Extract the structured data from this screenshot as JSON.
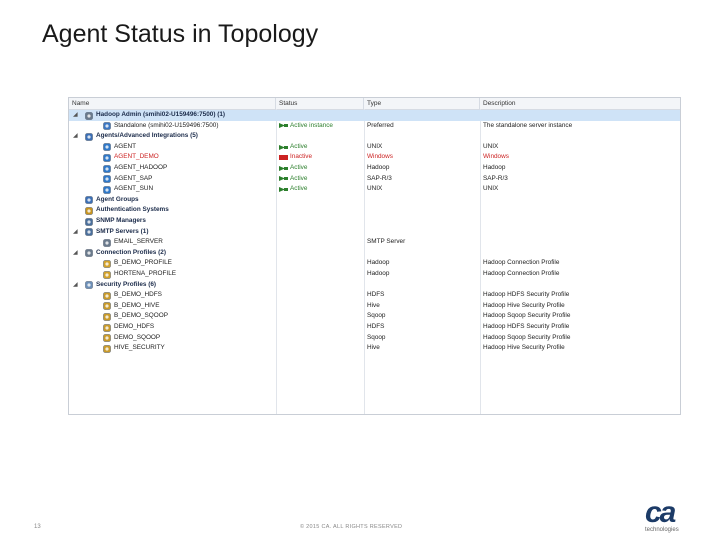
{
  "slide": {
    "title": "Agent Status in Topology",
    "page_number": "13",
    "copyright": "© 2015 CA. ALL RIGHTS RESERVED",
    "logo_text": "ca",
    "logo_subtext": "technologies"
  },
  "grid": {
    "columns": [
      "Name",
      "Status",
      "Type",
      "Description"
    ],
    "rows": [
      {
        "level": 0,
        "expander": "◢",
        "icon": "server-icon",
        "name": "Hadoop Admin (smihi02-U159496:7500) (1)",
        "bold": true,
        "status": "",
        "type": "",
        "desc": "",
        "selected": true
      },
      {
        "level": 1,
        "expander": "",
        "icon": "standalone-icon",
        "name": "Standalone (smihi02-U159496:7500)",
        "bold": false,
        "status": "Active instance",
        "status_kind": "ok",
        "type": "Preferred",
        "desc": "The standalone server instance",
        "desc_kind": "normal"
      },
      {
        "level": 0,
        "expander": "◢",
        "icon": "agent-group-icon",
        "name": "Agents/Advanced Integrations (5)",
        "bold": true,
        "status": "",
        "type": "",
        "desc": ""
      },
      {
        "level": 1,
        "expander": "",
        "icon": "agent-icon",
        "name": "AGENT",
        "bold": false,
        "status": "Active",
        "status_kind": "ok",
        "type": "UNIX",
        "desc": "UNIX"
      },
      {
        "level": 1,
        "expander": "",
        "icon": "agent-icon",
        "name": "AGENT_DEMO",
        "bold": false,
        "status": "Inactive",
        "status_kind": "bad",
        "type": "Windows",
        "desc": "Windows",
        "row_kind": "bad"
      },
      {
        "level": 1,
        "expander": "",
        "icon": "agent-icon",
        "name": "AGENT_HADOOP",
        "bold": false,
        "status": "Active",
        "status_kind": "ok",
        "type": "Hadoop",
        "desc": "Hadoop"
      },
      {
        "level": 1,
        "expander": "",
        "icon": "agent-icon",
        "name": "AGENT_SAP",
        "bold": false,
        "status": "Active",
        "status_kind": "ok",
        "type": "SAP-R/3",
        "desc": "SAP-R/3"
      },
      {
        "level": 1,
        "expander": "",
        "icon": "agent-icon",
        "name": "AGENT_SUN",
        "bold": false,
        "status": "Active",
        "status_kind": "ok",
        "type": "UNIX",
        "desc": "UNIX"
      },
      {
        "level": 0,
        "expander": "",
        "icon": "agent-groups-icon",
        "name": "Agent Groups",
        "bold": true,
        "status": "",
        "type": "",
        "desc": ""
      },
      {
        "level": 0,
        "expander": "",
        "icon": "auth-icon",
        "name": "Authentication Systems",
        "bold": true,
        "status": "",
        "type": "",
        "desc": ""
      },
      {
        "level": 0,
        "expander": "",
        "icon": "snmp-icon",
        "name": "SNMP Managers",
        "bold": true,
        "status": "",
        "type": "",
        "desc": ""
      },
      {
        "level": 0,
        "expander": "◢",
        "icon": "smtp-icon",
        "name": "SMTP Servers (1)",
        "bold": true,
        "status": "",
        "type": "",
        "desc": ""
      },
      {
        "level": 1,
        "expander": "",
        "icon": "email-server-icon",
        "name": "EMAIL_SERVER",
        "bold": false,
        "status": "",
        "type": "SMTP Server",
        "desc": ""
      },
      {
        "level": 0,
        "expander": "◢",
        "icon": "connection-icon",
        "name": "Connection Profiles (2)",
        "bold": true,
        "status": "",
        "type": "",
        "desc": ""
      },
      {
        "level": 1,
        "expander": "",
        "icon": "profile-icon",
        "name": "B_DEMO_PROFILE",
        "bold": false,
        "status": "",
        "type": "Hadoop",
        "desc": "Hadoop Connection Profile"
      },
      {
        "level": 1,
        "expander": "",
        "icon": "profile-icon",
        "name": "HORTENA_PROFILE",
        "bold": false,
        "status": "",
        "type": "Hadoop",
        "desc": "Hadoop Connection Profile"
      },
      {
        "level": 0,
        "expander": "◢",
        "icon": "security-icon",
        "name": "Security Profiles (6)",
        "bold": true,
        "status": "",
        "type": "",
        "desc": ""
      },
      {
        "level": 1,
        "expander": "",
        "icon": "sec-profile-icon",
        "name": "B_DEMO_HDFS",
        "bold": false,
        "status": "",
        "type": "HDFS",
        "desc": "Hadoop HDFS Security Profile"
      },
      {
        "level": 1,
        "expander": "",
        "icon": "sec-profile-icon",
        "name": "B_DEMO_HIVE",
        "bold": false,
        "status": "",
        "type": "Hive",
        "desc": "Hadoop Hive Security Profile"
      },
      {
        "level": 1,
        "expander": "",
        "icon": "sec-profile-icon",
        "name": "B_DEMO_SQOOP",
        "bold": false,
        "status": "",
        "type": "Sqoop",
        "desc": "Hadoop Sqoop Security Profile"
      },
      {
        "level": 1,
        "expander": "",
        "icon": "sec-profile-icon",
        "name": "DEMO_HDFS",
        "bold": false,
        "status": "",
        "type": "HDFS",
        "desc": "Hadoop HDFS Security Profile"
      },
      {
        "level": 1,
        "expander": "",
        "icon": "sec-profile-icon",
        "name": "DEMO_SQOOP",
        "bold": false,
        "status": "",
        "type": "Sqoop",
        "desc": "Hadoop Sqoop Security Profile"
      },
      {
        "level": 1,
        "expander": "",
        "icon": "sec-profile-icon",
        "name": "HIVE_SECURITY",
        "bold": false,
        "status": "",
        "type": "Hive",
        "desc": "Hadoop Hive Security Profile"
      }
    ]
  },
  "colors": {
    "active": "#2c7f2c",
    "inactive": "#cc2222",
    "selected_row": "#cfe3f7",
    "brand": "#1c3b67"
  }
}
